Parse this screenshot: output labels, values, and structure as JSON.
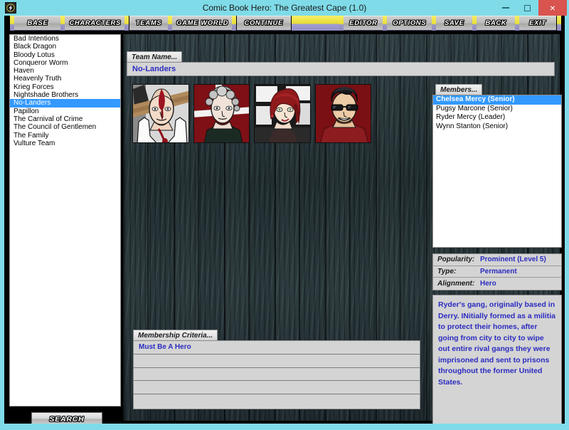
{
  "window": {
    "title": "Comic Book Hero: The Greatest Cape (1.0)",
    "app_icon": "lightning-bolt-icon",
    "controls": {
      "minimize": "minimize-icon",
      "maximize": "maximize-icon",
      "close": "×"
    },
    "accent_cyan": "#7fdbe8",
    "close_red": "#d9534f"
  },
  "toolbar": {
    "buttons": [
      {
        "label": "BASE"
      },
      {
        "label": "CHARACTERS"
      },
      {
        "label": "TEAMS"
      },
      {
        "label": "GAME WORLD"
      },
      {
        "label": "CONTINUE"
      },
      {
        "label": "EDITOR"
      },
      {
        "label": "OPTIONS"
      },
      {
        "label": "SAVE"
      },
      {
        "label": "BACK"
      },
      {
        "label": "EXIT"
      }
    ],
    "separator_color": "#e8dc35"
  },
  "sidebar": {
    "items": [
      {
        "label": "Bad Intentions",
        "selected": false
      },
      {
        "label": "Black Dragon",
        "selected": false
      },
      {
        "label": "Bloody Lotus",
        "selected": false
      },
      {
        "label": "Conqueror Worm",
        "selected": false
      },
      {
        "label": "Haven",
        "selected": false
      },
      {
        "label": "Heavenly Truth",
        "selected": false
      },
      {
        "label": "Krieg Forces",
        "selected": false
      },
      {
        "label": "Nightshade Brothers",
        "selected": false
      },
      {
        "label": "No-Landers",
        "selected": true
      },
      {
        "label": "Papillon",
        "selected": false
      },
      {
        "label": "The Carnival of Crime",
        "selected": false
      },
      {
        "label": "The Council of Gentlemen",
        "selected": false
      },
      {
        "label": "The Family",
        "selected": false
      },
      {
        "label": "Vulture Team",
        "selected": false
      }
    ],
    "search_label": "SEARCH",
    "selection_color": "#3399ff"
  },
  "team": {
    "name_label": "Team Name...",
    "name_value": "No-Landers",
    "portraits": [
      {
        "name": "portrait-ryder-mercy"
      },
      {
        "name": "portrait-wynn-stanton"
      },
      {
        "name": "portrait-chelsea-mercy"
      },
      {
        "name": "portrait-pugsy-marcone"
      }
    ]
  },
  "members": {
    "label": "Members...",
    "items": [
      {
        "label": "Chelsea Mercy (Senior)",
        "selected": true
      },
      {
        "label": "Pugsy Marcone (Senior)",
        "selected": false
      },
      {
        "label": "Ryder Mercy (Leader)",
        "selected": false
      },
      {
        "label": "Wynn Stanton (Senior)",
        "selected": false
      }
    ]
  },
  "stats": [
    {
      "key": "Popularity:",
      "value": "Prominent (Level 5)"
    },
    {
      "key": "Type:",
      "value": "Permanent"
    },
    {
      "key": "Alignment:",
      "value": "Hero"
    }
  ],
  "description": {
    "text": "Ryder's gang, originally based in Derry. INitially formed as a militia to protect their homes, after going from city to city to wipe out entire rival gangs they were imprisoned and sent to prisons throughout the former United States."
  },
  "criteria": {
    "label": "Membership Criteria...",
    "rows": [
      {
        "label": "Must Be A Hero"
      },
      {
        "label": ""
      },
      {
        "label": ""
      },
      {
        "label": ""
      },
      {
        "label": ""
      }
    ]
  }
}
